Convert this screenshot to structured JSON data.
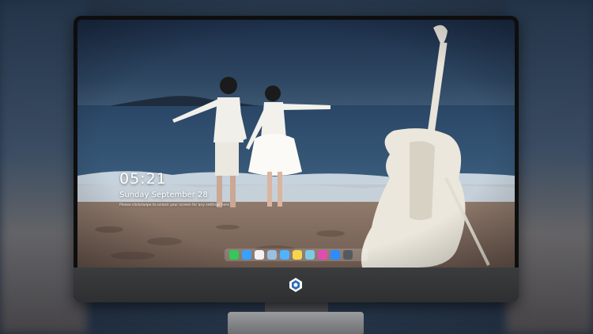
{
  "lock_screen": {
    "time": "05:21",
    "date": "Sunday September  28",
    "subtitle": "Please click/swipe to unlock your screen for any settings here"
  },
  "dock": {
    "apps": [
      {
        "name": "messages",
        "color": "#34c759"
      },
      {
        "name": "finder",
        "color": "#3aa0ff"
      },
      {
        "name": "clock",
        "color": "#f2f2f2"
      },
      {
        "name": "preview",
        "color": "#9ac0e0"
      },
      {
        "name": "imovie",
        "color": "#4fb3ff"
      },
      {
        "name": "notes",
        "color": "#f7d54a"
      },
      {
        "name": "photos",
        "color": "#7ec8e3"
      },
      {
        "name": "itunes",
        "color": "#e24cb1"
      },
      {
        "name": "app-store",
        "color": "#2d8cff"
      },
      {
        "name": "screenshot",
        "color": "#555a60"
      }
    ]
  }
}
